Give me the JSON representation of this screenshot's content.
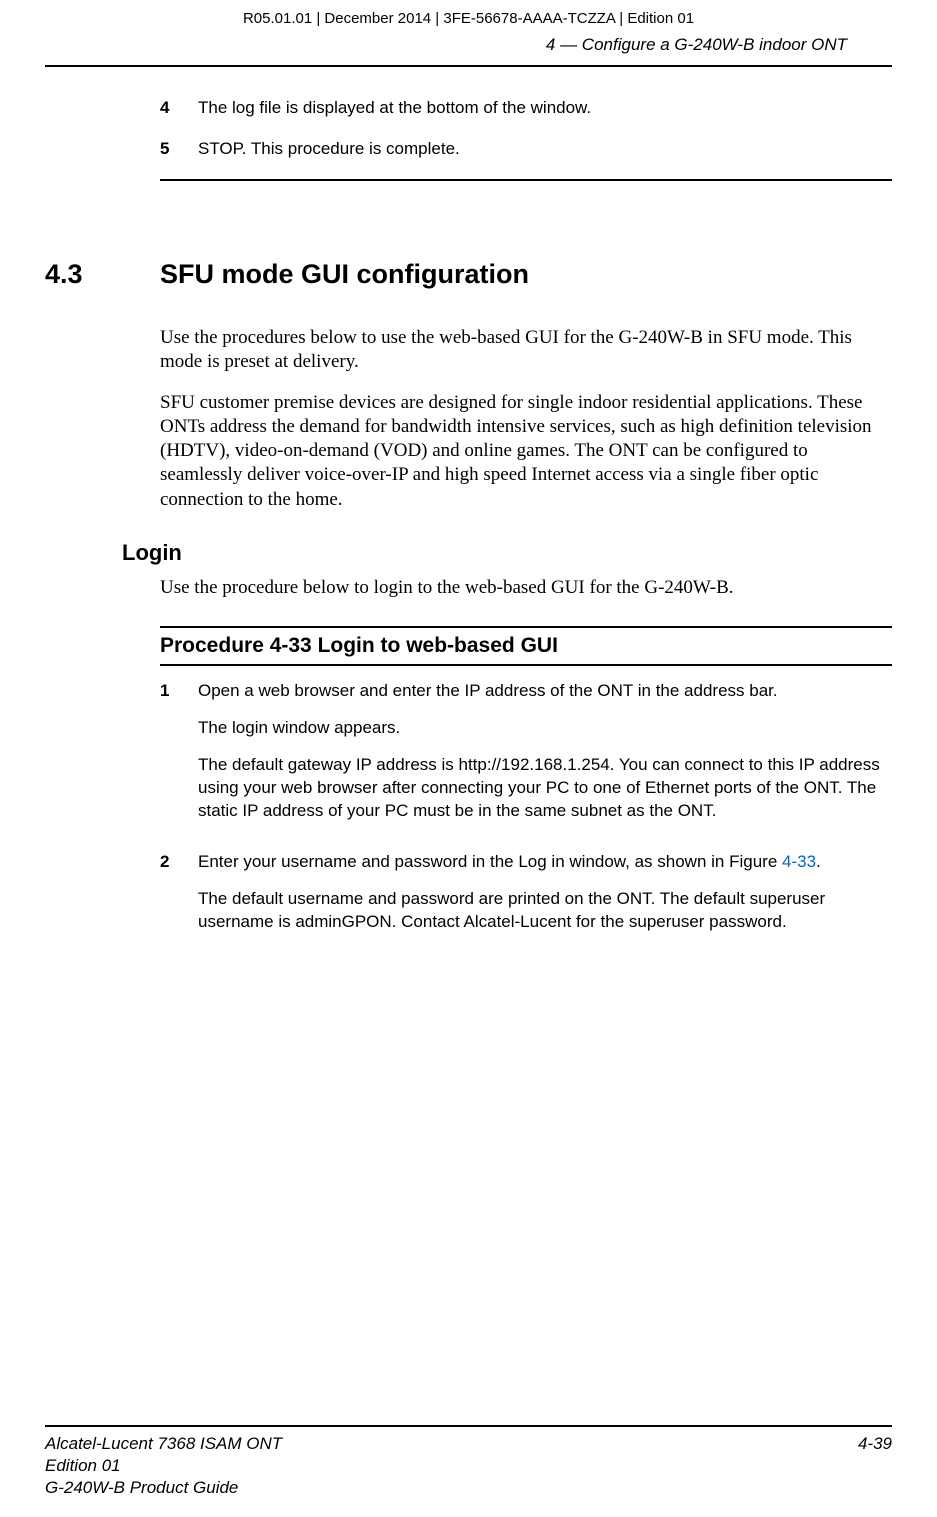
{
  "header": {
    "top": "R05.01.01 | December 2014 | 3FE-56678-AAAA-TCZZA | Edition 01",
    "chapter": "4 —  Configure a G-240W-B indoor ONT"
  },
  "prev_steps": {
    "s4": {
      "num": "4",
      "text": "The log file is displayed at the bottom of the window."
    },
    "s5": {
      "num": "5",
      "text": "STOP. This procedure is complete."
    }
  },
  "section": {
    "num": "4.3",
    "title": "SFU mode GUI configuration",
    "para1": "Use the procedures below to use the web-based GUI for the G-240W-B in SFU mode. This mode is preset at delivery.",
    "para2": "SFU customer premise devices are designed for single indoor residential applications. These ONTs address the demand for bandwidth intensive services, such as high definition television (HDTV), video-on-demand (VOD) and online games. The ONT can be configured to seamlessly deliver voice-over-IP and high speed Internet access via a single fiber optic connection to the home."
  },
  "login": {
    "heading": "Login",
    "para": "Use the procedure below to login to the web-based GUI for the G-240W-B."
  },
  "procedure": {
    "title": "Procedure 4-33  Login to web-based GUI",
    "s1": {
      "num": "1",
      "p1": "Open a web browser and enter the IP address of the ONT in the address bar.",
      "p2": "The login window appears.",
      "p3": "The default gateway IP address is http://192.168.1.254. You can connect to this IP address using your web browser after connecting your PC to one of Ethernet ports of the ONT. The static IP address of your PC must be in the same subnet as the ONT."
    },
    "s2": {
      "num": "2",
      "p1_pre": "Enter your username and password in the Log in window, as shown in Figure ",
      "p1_ref": "4-33",
      "p1_post": ".",
      "p2": "The default username and password are printed on the ONT. The default superuser username is adminGPON. Contact Alcatel-Lucent for the superuser password."
    }
  },
  "footer": {
    "left1": "Alcatel-Lucent 7368 ISAM ONT",
    "left2": "Edition 01",
    "left3": "G-240W-B Product Guide",
    "right": "4-39"
  }
}
